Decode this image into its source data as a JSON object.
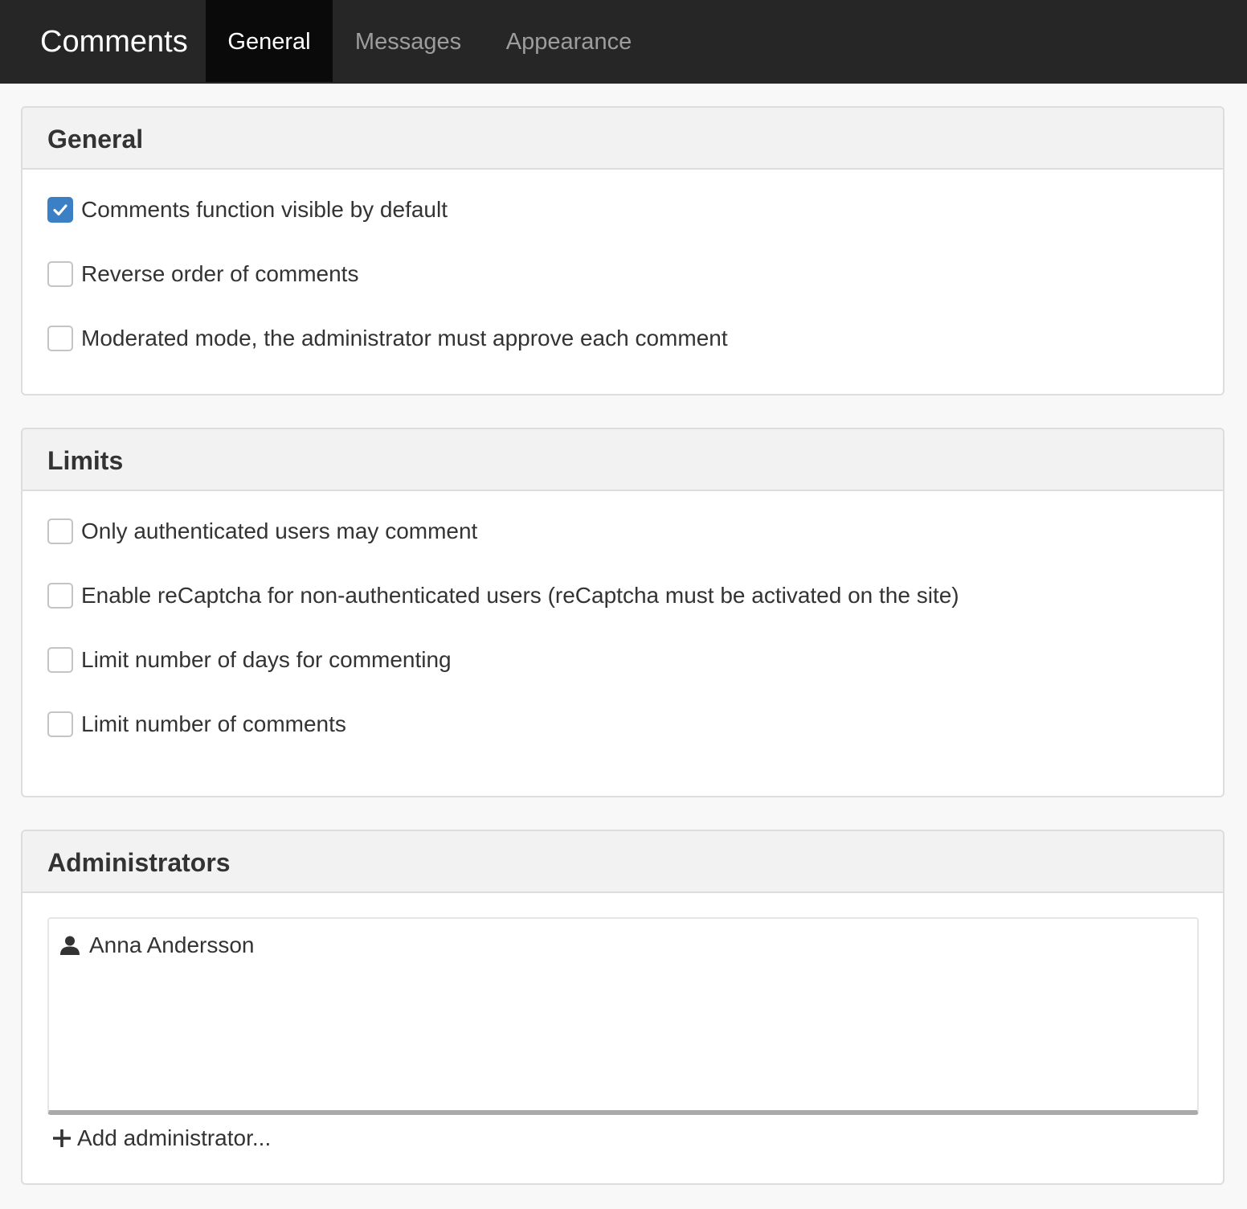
{
  "header": {
    "title": "Comments",
    "tabs": [
      {
        "label": "General",
        "active": true
      },
      {
        "label": "Messages",
        "active": false
      },
      {
        "label": "Appearance",
        "active": false
      }
    ]
  },
  "general": {
    "heading": "General",
    "options": [
      {
        "label": "Comments function visible by default",
        "checked": true
      },
      {
        "label": "Reverse order of comments",
        "checked": false
      },
      {
        "label": "Moderated mode, the administrator must approve each comment",
        "checked": false
      }
    ]
  },
  "limits": {
    "heading": "Limits",
    "options": [
      {
        "label": "Only authenticated users may comment",
        "checked": false
      },
      {
        "label": "Enable reCaptcha for non-authenticated users (reCaptcha must be activated on the site)",
        "checked": false
      },
      {
        "label": "Limit number of days for commenting",
        "checked": false
      },
      {
        "label": "Limit number of comments",
        "checked": false
      }
    ]
  },
  "administrators": {
    "heading": "Administrators",
    "list": [
      {
        "name": "Anna Andersson",
        "icon": "user-icon"
      }
    ],
    "add_label": "Add administrator..."
  },
  "colors": {
    "topbar": "#262626",
    "active_tab": "#0a0a0a",
    "checkbox_checked": "#3b7fc4"
  }
}
